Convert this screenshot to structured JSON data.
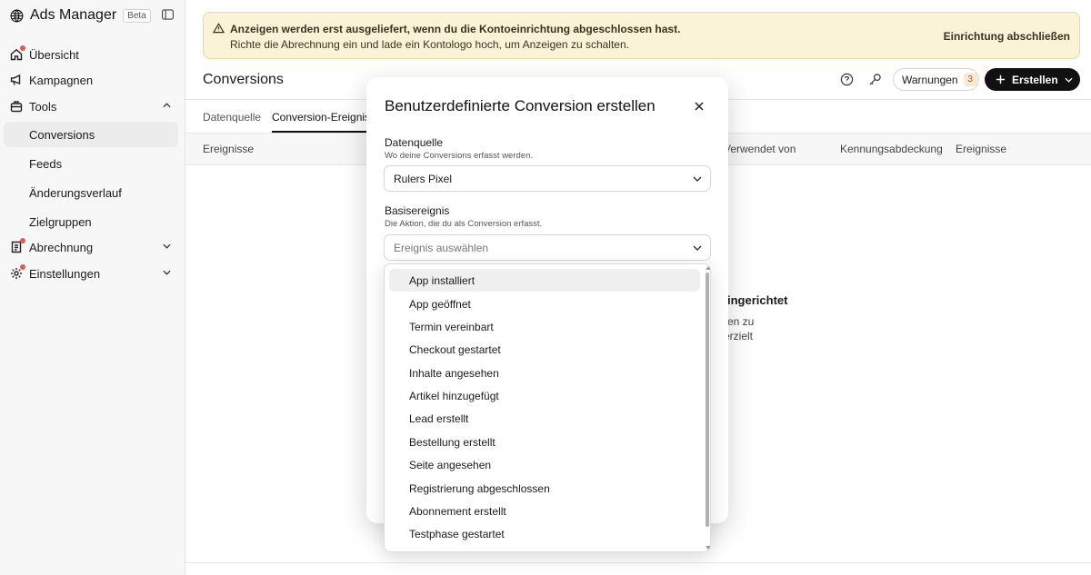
{
  "app": {
    "title": "Ads Manager",
    "badge": "Beta"
  },
  "sidebar": {
    "items": [
      {
        "label": "Übersicht"
      },
      {
        "label": "Kampagnen"
      },
      {
        "label": "Tools"
      },
      {
        "label": "Conversions"
      },
      {
        "label": "Feeds"
      },
      {
        "label": "Änderungsverlauf"
      },
      {
        "label": "Zielgruppen"
      },
      {
        "label": "Abrechnung"
      },
      {
        "label": "Einstellungen"
      }
    ]
  },
  "banner": {
    "title": "Anzeigen werden erst ausgeliefert, wenn du die Kontoeinrichtung abgeschlossen hast.",
    "text": "Richte die Abrechnung ein und lade ein Kontologo hoch, um Anzeigen zu schalten.",
    "action": "Einrichtung abschließen"
  },
  "header": {
    "title": "Conversions",
    "warnings_label": "Warnungen",
    "warnings_count": "3",
    "create_label": "Erstellen"
  },
  "tabs": [
    {
      "label": "Datenquelle"
    },
    {
      "label": "Conversion-Ereignisse"
    }
  ],
  "table": {
    "columns": [
      "Ereignisse",
      "Verwendet von",
      "Kennungsabdeckung",
      "Ereignisse"
    ]
  },
  "empty_state": {
    "title": "ingerichtet",
    "line1": "en zu",
    "line2": "erzielt"
  },
  "modal": {
    "title": "Benutzerdefinierte Conversion erstellen",
    "source": {
      "label": "Datenquelle",
      "help": "Wo deine Conversions erfasst werden.",
      "value": "Rulers Pixel"
    },
    "base_event": {
      "label": "Basisereignis",
      "help": "Die Aktion, die du als Conversion erfasst.",
      "placeholder": "Ereignis auswählen"
    }
  },
  "dropdown": {
    "options": [
      "App installiert",
      "App geöffnet",
      "Termin vereinbart",
      "Checkout gestartet",
      "Inhalte angesehen",
      "Artikel hinzugefügt",
      "Lead erstellt",
      "Bestellung erstellt",
      "Seite angesehen",
      "Registrierung abgeschlossen",
      "Abonnement erstellt",
      "Testphase gestartet"
    ]
  },
  "colors": {
    "accent": "#111111",
    "banner_bg": "#faf3d8",
    "notification_dot": "#e05a5a"
  }
}
